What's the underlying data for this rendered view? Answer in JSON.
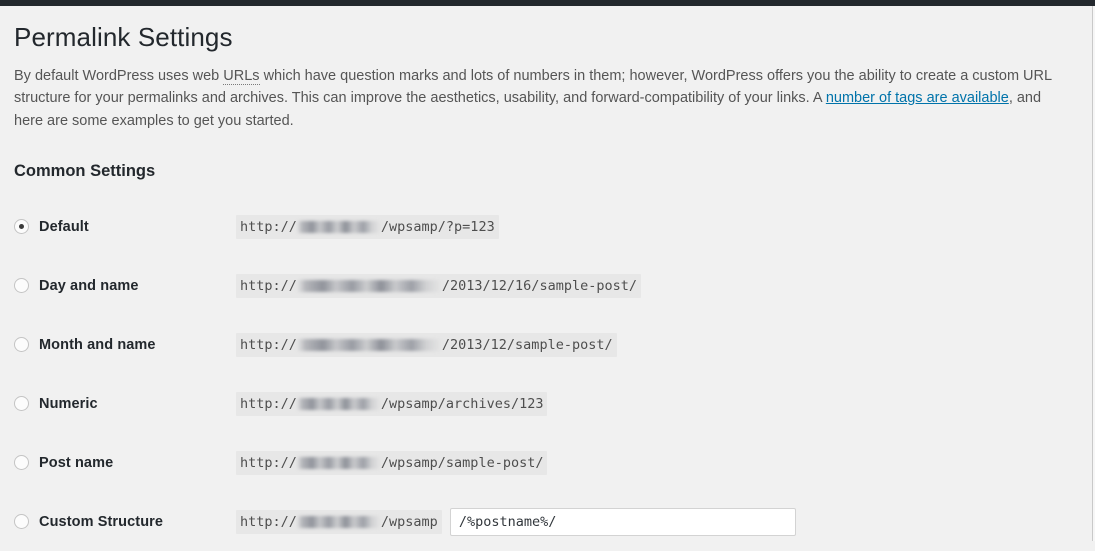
{
  "admin_bar": {
    "present": true,
    "color": "#23282d"
  },
  "page": {
    "title": "Permalink Settings",
    "background": "#f1f1f1"
  },
  "intro": {
    "part1": "By default WordPress uses web ",
    "abbr": "URLs",
    "part2": " which have question marks and lots of numbers in them; however, WordPress offers you the ability to create a custom URL structure for your permalinks and archives. This can improve the aesthetics, usability, and forward-compatibility of your links. A ",
    "link_text": "number of tags are available",
    "link_color": "#0073aa",
    "part3": ", and here are some examples to get you started."
  },
  "common_settings": {
    "heading": "Common Settings",
    "options": [
      {
        "label": "Default",
        "selected": true,
        "url_prefix": "http://",
        "host_redacted": true,
        "host_width": 84,
        "url_suffix": "/wpsamp/?p=123"
      },
      {
        "label": "Day and name",
        "selected": false,
        "url_prefix": "http://",
        "host_redacted": true,
        "host_width": 145,
        "url_suffix": "/2013/12/16/sample-post/"
      },
      {
        "label": "Month and name",
        "selected": false,
        "url_prefix": "http://",
        "host_redacted": true,
        "host_width": 145,
        "url_suffix": "/2013/12/sample-post/"
      },
      {
        "label": "Numeric",
        "selected": false,
        "url_prefix": "http://",
        "host_redacted": true,
        "host_width": 84,
        "url_suffix": "/wpsamp/archives/123"
      },
      {
        "label": "Post name",
        "selected": false,
        "url_prefix": "http://",
        "host_redacted": true,
        "host_width": 84,
        "url_suffix": "/wpsamp/sample-post/"
      }
    ],
    "custom": {
      "label": "Custom Structure",
      "selected": false,
      "url_prefix": "http://",
      "host_redacted": true,
      "host_width": 84,
      "url_suffix": "/wpsamp",
      "input_value": "/%postname%/",
      "input_placeholder": ""
    }
  }
}
